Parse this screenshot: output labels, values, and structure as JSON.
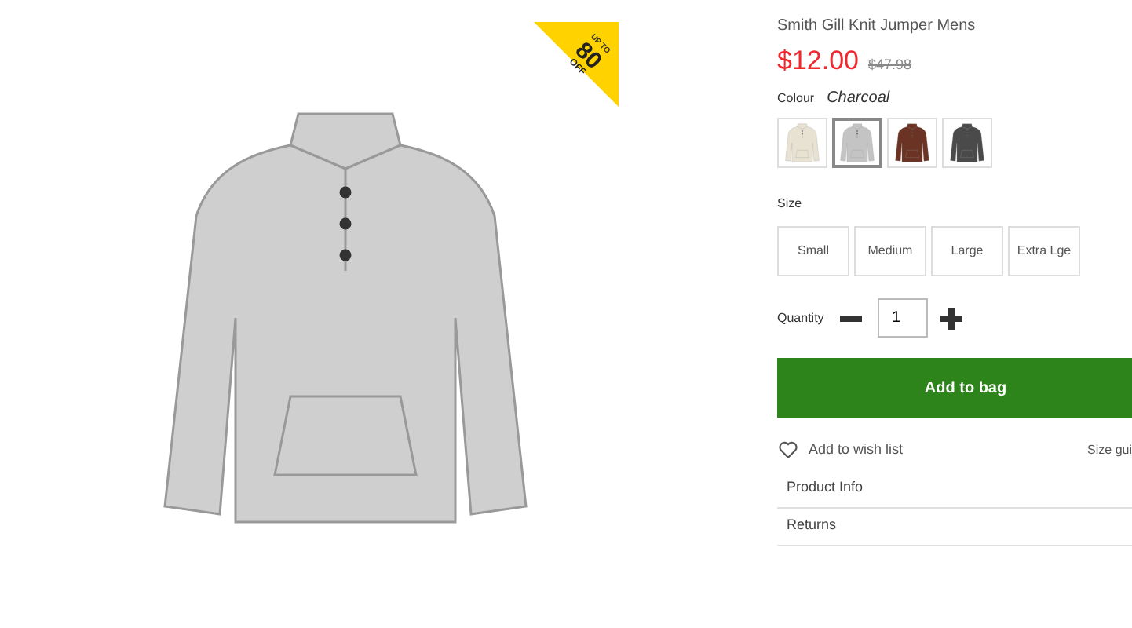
{
  "badge": {
    "top": "UP TO",
    "value": "80",
    "bottom": "OFF"
  },
  "product": {
    "title": "Smith Gill Knit Jumper Mens",
    "price": "$12.00",
    "old_price": "$47.98"
  },
  "colour": {
    "label": "Colour",
    "value": "Charcoal",
    "swatches": [
      {
        "color": "#e8e2d2",
        "selected": false
      },
      {
        "color": "#c4c4c4",
        "selected": true
      },
      {
        "color": "#6a3324",
        "selected": false
      },
      {
        "color": "#4a4a4a",
        "selected": false
      }
    ]
  },
  "size": {
    "label": "Size",
    "options": [
      {
        "label": "Small",
        "selected": false
      },
      {
        "label": "Medium",
        "selected": false
      },
      {
        "label": "Large",
        "selected": false
      },
      {
        "label": "Extra Lge",
        "selected": false
      }
    ]
  },
  "quantity": {
    "label": "Quantity",
    "value": "1"
  },
  "add_button": "Add to bag",
  "wishlist": "Add to wish list",
  "size_guide": "Size gui",
  "sections": [
    "Product Info",
    "Returns"
  ]
}
